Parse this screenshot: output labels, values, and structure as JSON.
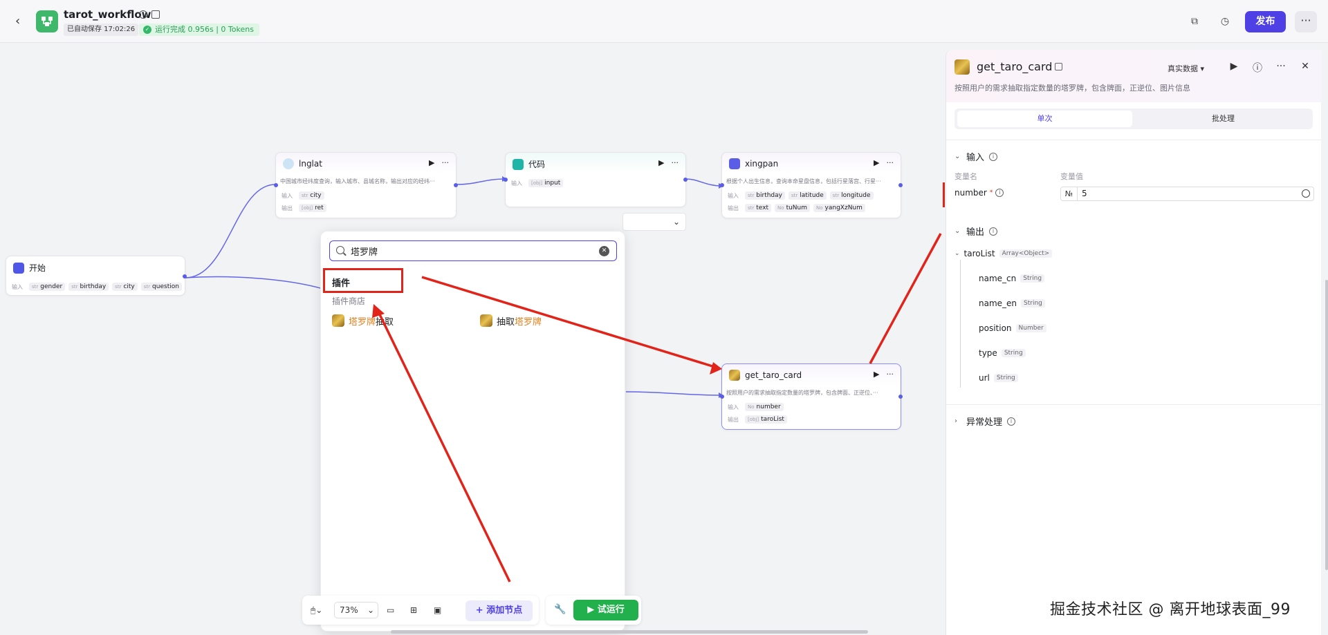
{
  "header": {
    "title": "tarot_workflow",
    "autosave": "已自动保存 17:02:26",
    "run_status": "运行完成 0.956s | 0 Tokens",
    "publish_label": "发布",
    "more_label": "···"
  },
  "nodes": {
    "start": {
      "title": "开始",
      "input_label": "输入",
      "inputs": [
        {
          "type": "str",
          "name": "gender"
        },
        {
          "type": "str",
          "name": "birthday"
        },
        {
          "type": "str",
          "name": "city"
        },
        {
          "type": "str",
          "name": "question"
        }
      ]
    },
    "lnglat": {
      "title": "lnglat",
      "desc": "中国城市经纬度查询，输入城市、县城名称，输出对应的经纬···",
      "input_label": "输入",
      "output_label": "输出",
      "inputs": [
        {
          "type": "str",
          "name": "city"
        }
      ],
      "outputs": [
        {
          "type": "[obj]",
          "name": "ret"
        }
      ]
    },
    "code": {
      "title": "代码",
      "input_label": "输入",
      "inputs": [
        {
          "type": "[obj]",
          "name": "input"
        }
      ]
    },
    "xingpan": {
      "title": "xingpan",
      "desc": "根据个人出生信息，查询本命星盘信息，包括行星落宫、行星···",
      "input_label": "输入",
      "output_label": "输出",
      "inputs": [
        {
          "type": "str",
          "name": "birthday"
        },
        {
          "type": "str",
          "name": "latitude"
        },
        {
          "type": "str",
          "name": "longitude"
        }
      ],
      "outputs": [
        {
          "type": "str",
          "name": "text"
        },
        {
          "type": "No",
          "name": "tuNum"
        },
        {
          "type": "No",
          "name": "yangXzNum"
        }
      ]
    },
    "get_taro_card": {
      "title": "get_taro_card",
      "desc": "按照用户的需求抽取指定数量的塔罗牌，包含牌面、正逆位、···",
      "input_label": "输入",
      "output_label": "输出",
      "inputs": [
        {
          "type": "No",
          "name": "number"
        }
      ],
      "outputs": [
        {
          "type": "[obj]",
          "name": "taroList"
        }
      ]
    }
  },
  "popup": {
    "search_value": "塔罗牌",
    "section_title": "插件",
    "section_sub": "插件商店",
    "results": [
      {
        "highlight": "塔罗牌",
        "rest": "抽取"
      },
      {
        "prefix": "抽取",
        "highlight": "塔罗牌"
      }
    ]
  },
  "toolbar": {
    "zoom": "73%",
    "add_node": "添加节点",
    "try_run": "试运行"
  },
  "panel": {
    "title": "get_taro_card",
    "data_mode": "真实数据",
    "desc": "按照用户的需求抽取指定数量的塔罗牌，包含牌面，正逆位、图片信息",
    "tab_single": "单次",
    "tab_batch": "批处理",
    "input_section": "输入",
    "col_var_name": "变量名",
    "col_var_value": "变量值",
    "var_name": "number",
    "var_required": "*",
    "var_type": "№",
    "var_value": "5",
    "output_section": "输出",
    "output_root": {
      "name": "taroList",
      "type": "Array<Object>"
    },
    "output_fields": [
      {
        "name": "name_cn",
        "type": "String"
      },
      {
        "name": "name_en",
        "type": "String"
      },
      {
        "name": "position",
        "type": "Number"
      },
      {
        "name": "type",
        "type": "String"
      },
      {
        "name": "url",
        "type": "String"
      }
    ],
    "error_section": "异常处理"
  },
  "watermark": "掘金技术社区 @ 离开地球表面_99",
  "colors": {
    "accent": "#4e40e5",
    "run_green": "#22b04c",
    "annotation_red": "#e2231a",
    "highlight_orange": "#e0801e"
  }
}
